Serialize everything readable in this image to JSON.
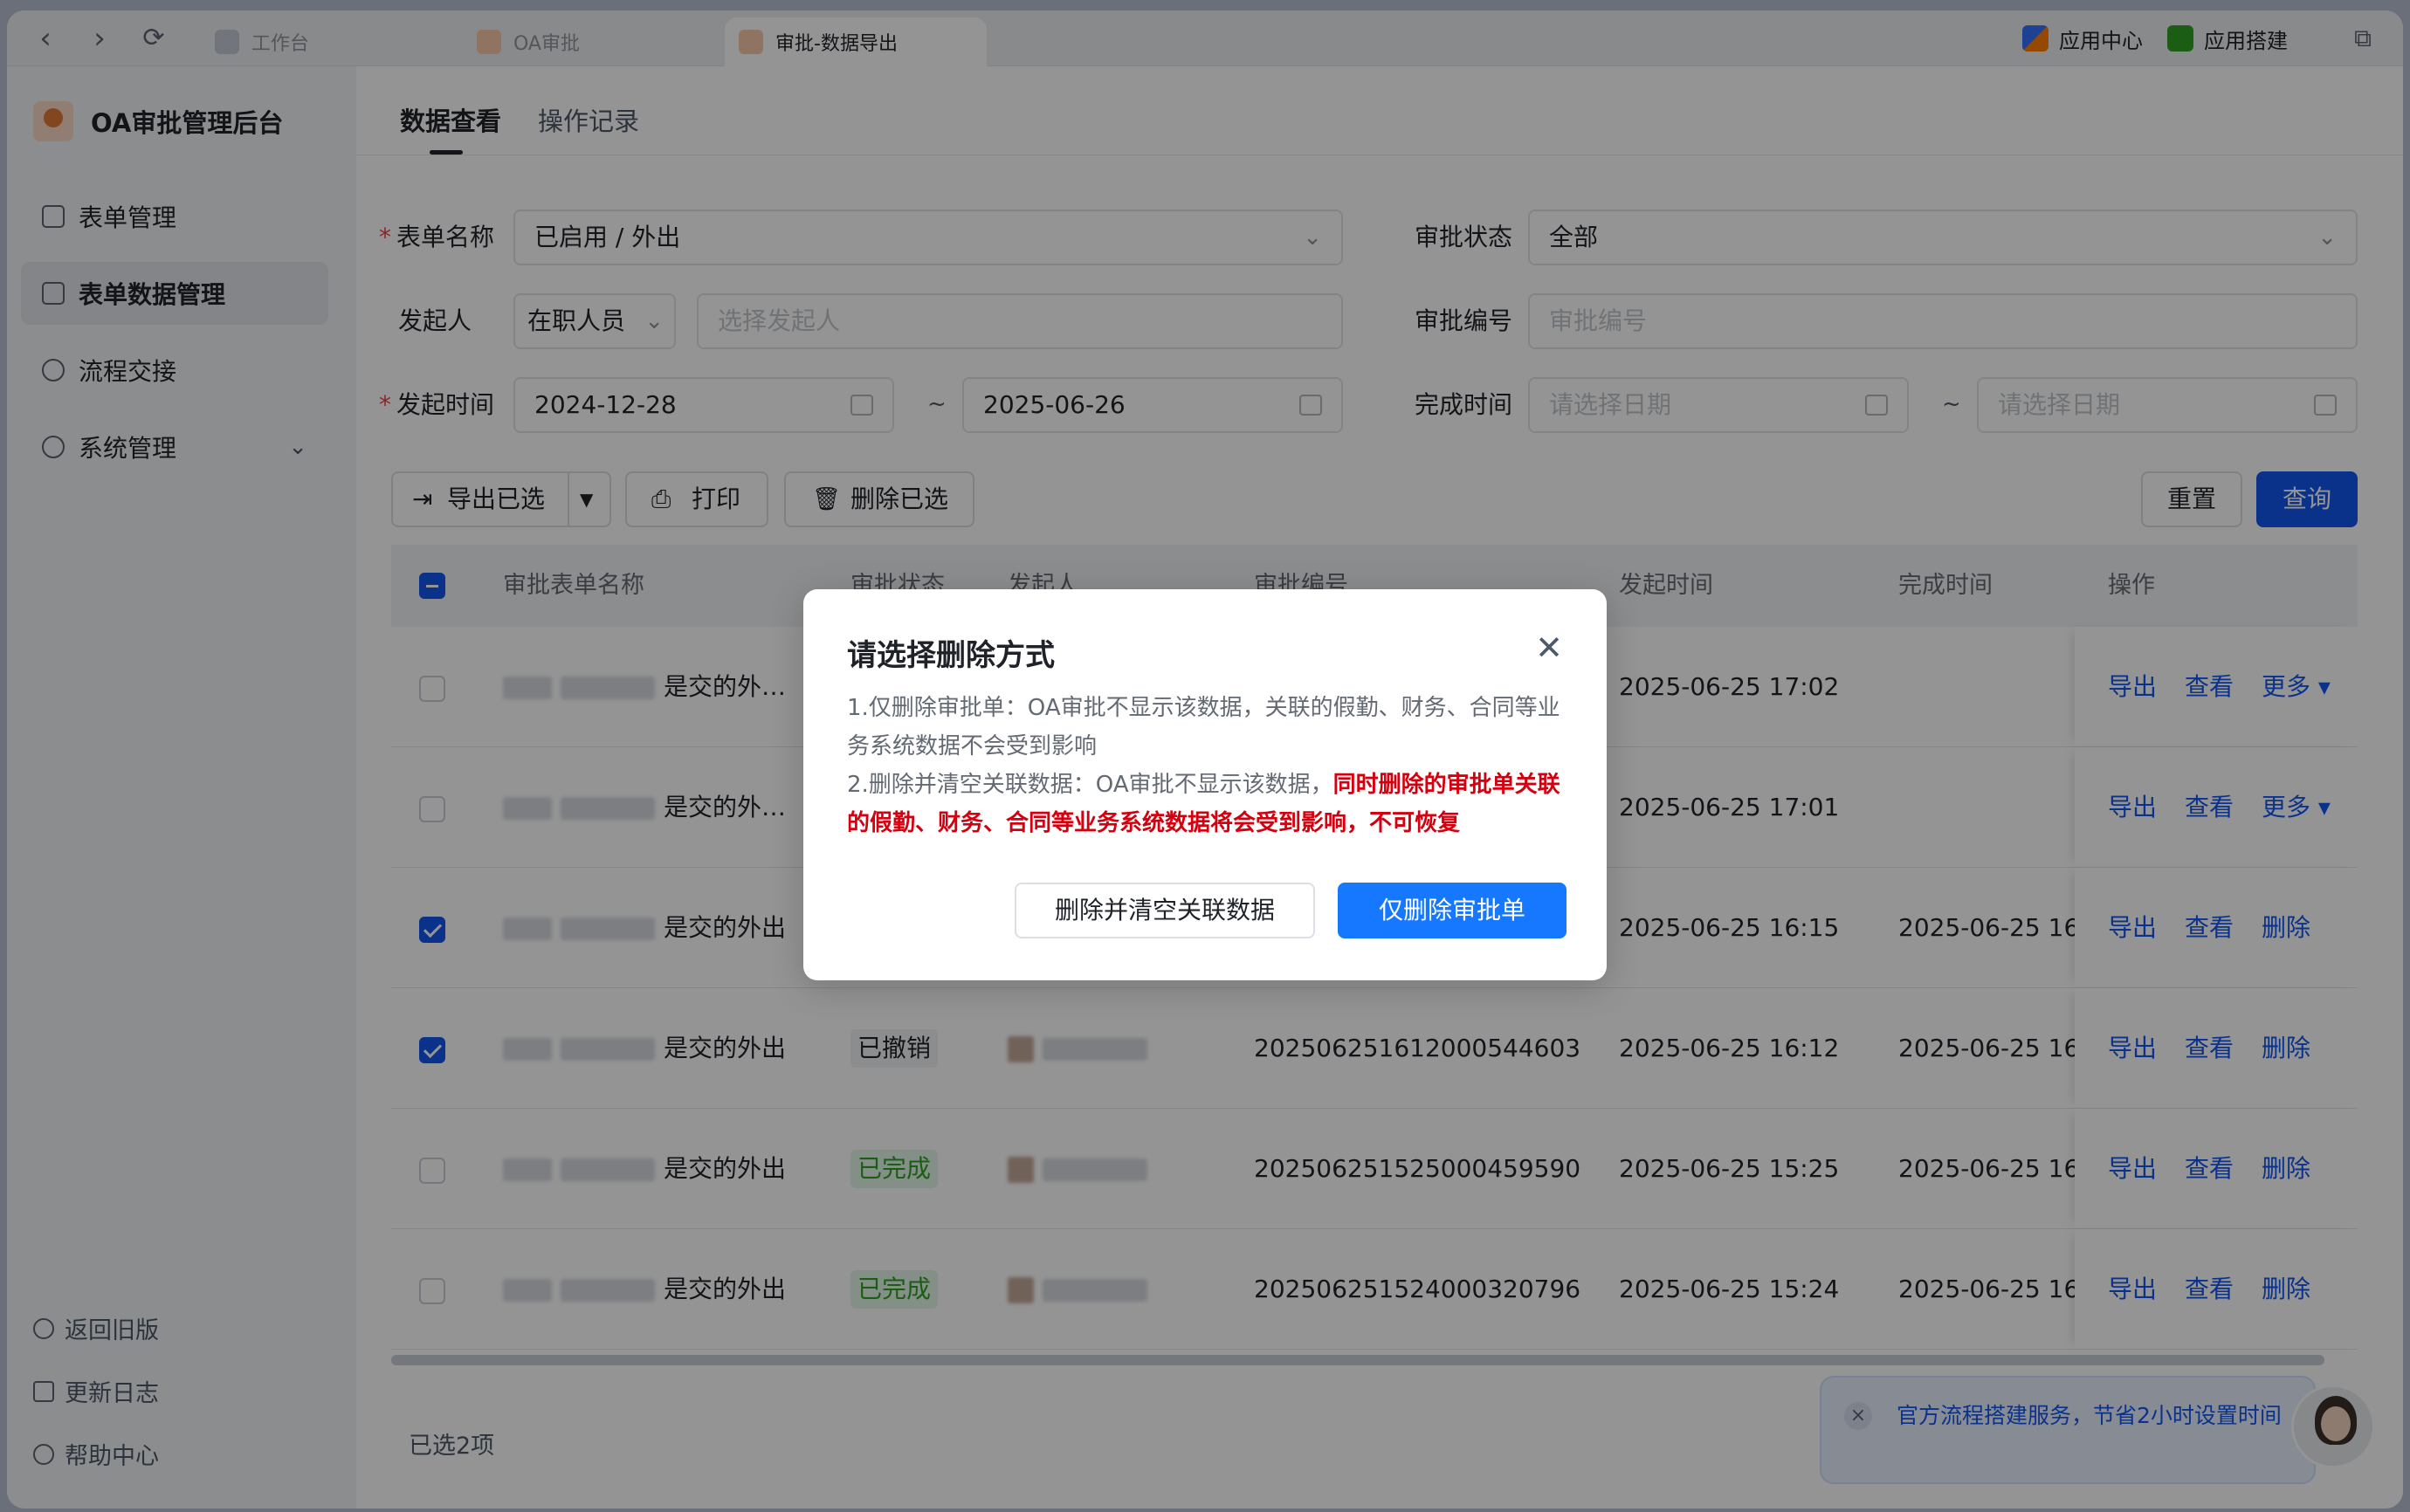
{
  "browser": {
    "tabs": [
      {
        "label": "工作台",
        "active": false
      },
      {
        "label": "OA审批",
        "active": false
      },
      {
        "label": "审批-数据导出",
        "active": true
      }
    ],
    "right_items": [
      "应用中心",
      "应用搭建"
    ]
  },
  "sidebar": {
    "brand": "OA审批管理后台",
    "items": [
      {
        "label": "表单管理",
        "icon": "form-icon"
      },
      {
        "label": "表单数据管理",
        "icon": "form-data-icon",
        "active": true
      },
      {
        "label": "流程交接",
        "icon": "user-transfer-icon"
      },
      {
        "label": "系统管理",
        "icon": "gear-icon",
        "expandable": true
      }
    ],
    "bottom": [
      {
        "label": "返回旧版",
        "icon": "back-icon"
      },
      {
        "label": "更新日志",
        "icon": "log-icon"
      },
      {
        "label": "帮助中心",
        "icon": "help-icon"
      }
    ]
  },
  "main_tabs": [
    {
      "label": "数据查看",
      "active": true
    },
    {
      "label": "操作记录",
      "active": false
    }
  ],
  "filters": {
    "form_name_label": "表单名称",
    "form_name_value": "已启用 / 外出",
    "status_label": "审批状态",
    "status_value": "全部",
    "initiator_label": "发起人",
    "initiator_scope": "在职人员",
    "initiator_placeholder": "选择发起人",
    "code_label": "审批编号",
    "code_placeholder": "审批编号",
    "start_time_label": "发起时间",
    "start_from": "2024-12-28",
    "start_to": "2025-06-26",
    "finish_time_label": "完成时间",
    "finish_placeholder_from": "请选择日期",
    "finish_placeholder_to": "请选择日期",
    "tilde": "~"
  },
  "toolbar": {
    "export_selected": "导出已选",
    "print": "打印",
    "delete_selected": "删除已选",
    "reset": "重置",
    "query": "查询"
  },
  "table": {
    "headers": [
      "审批表单名称",
      "审批状态",
      "发起人",
      "审批编号",
      "发起时间",
      "完成时间",
      "操作"
    ],
    "rows": [
      {
        "checked": false,
        "name": "是交的外…",
        "status": "",
        "status_tone": "",
        "code": "",
        "start": "2025-06-25 17:02",
        "finish": "",
        "ops": [
          "导出",
          "查看",
          "更多 ▾"
        ]
      },
      {
        "checked": false,
        "name": "是交的外…",
        "status": "",
        "status_tone": "",
        "code": "",
        "start": "2025-06-25 17:01",
        "finish": "",
        "ops": [
          "导出",
          "查看",
          "更多 ▾"
        ]
      },
      {
        "checked": true,
        "name": "是交的外出",
        "status": "",
        "status_tone": "",
        "code": "",
        "start": "2025-06-25 16:15",
        "finish": "2025-06-25 16",
        "ops": [
          "导出",
          "查看",
          "删除"
        ]
      },
      {
        "checked": true,
        "name": "是交的外出",
        "status": "已撤销",
        "status_tone": "gray",
        "code": "20250625161200054460​3",
        "start": "2025-06-25 16:12",
        "finish": "2025-06-25 16",
        "ops": [
          "导出",
          "查看",
          "删除"
        ]
      },
      {
        "checked": false,
        "name": "是交的外出",
        "status": "已完成",
        "status_tone": "green",
        "code": "202506251525000459590",
        "start": "2025-06-25 15:25",
        "finish": "2025-06-25 16",
        "ops": [
          "导出",
          "查看",
          "删除"
        ]
      },
      {
        "checked": false,
        "name": "是交的外出",
        "status": "已完成",
        "status_tone": "green",
        "code": "202506251524000320796",
        "start": "2025-06-25 15:24",
        "finish": "2025-06-25 16",
        "ops": [
          "导出",
          "查看",
          "删除"
        ]
      }
    ]
  },
  "selected_count": "已选2项",
  "promo": {
    "text": "官方流程搭建服务，节省2小时设置时间"
  },
  "modal": {
    "title": "请选择删除方式",
    "line1": "1.仅删除审批单：OA审批不显示该数据，关联的假勤、财务、合同等业务系统数据不会受到影响",
    "line2_prefix": "2.删除并清空关联数据：OA审批不显示该数据，",
    "line2_warning": "同时删除的审批单关联的假勤、财务、合同等业务系统数据将会受到影响，不可恢复",
    "btn_clear": "删除并清空关联数据",
    "btn_only": "仅删除审批单"
  },
  "colors": {
    "primary": "#1456f0",
    "modal_primary": "#1677ff",
    "warning": "#d4000f",
    "success": "#2ea121"
  }
}
